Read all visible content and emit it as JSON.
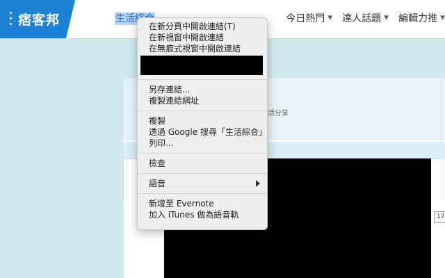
{
  "header": {
    "logo_text": "痞客邦",
    "active_nav": "生活綜合",
    "nav_items": [
      {
        "label": "今日熱門"
      },
      {
        "label": "達人話題"
      },
      {
        "label": "編輯力推"
      }
    ]
  },
  "card": {
    "subtitle": "活分享"
  },
  "side_badge": "17",
  "context_menu": {
    "open_new_tab": "在新分頁中開啟連結(T)",
    "open_new_window": "在新視窗中開啟連結",
    "open_incognito": "在無痕式視窗中開啟連結",
    "save_link": "另存連結...",
    "copy_link": "複製連結網址",
    "copy": "複製",
    "google_search": "透過 Google 搜尋「生活綜合」",
    "print": "列印...",
    "inspect": "檢查",
    "speech": "語音",
    "add_evernote": "新增至 Evernote",
    "add_itunes": "加入 iTunes 做為語音軌"
  }
}
